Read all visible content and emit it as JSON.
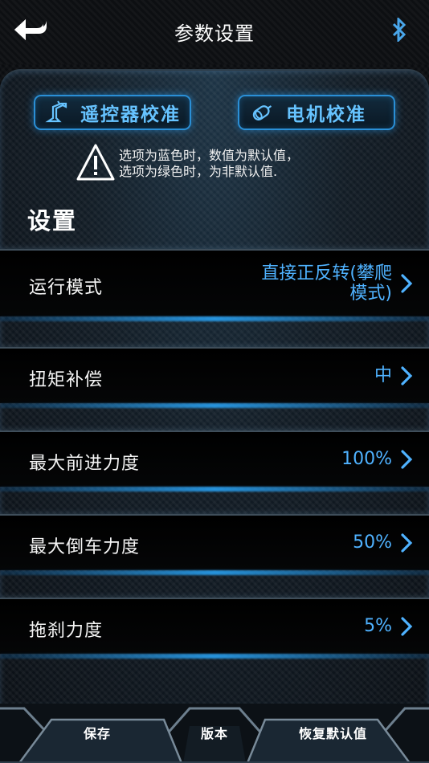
{
  "header": {
    "title": "参数设置",
    "back_icon": "back-arrow-icon",
    "bluetooth_icon": "bluetooth-icon"
  },
  "calibration": {
    "remote_label": "遥控器校准",
    "remote_icon": "remote-control-icon",
    "motor_label": "电机校准",
    "motor_icon": "motor-icon"
  },
  "warning": {
    "icon": "warning-triangle-icon",
    "line1": "选项为蓝色时，数值为默认值，",
    "line2": "选项为绿色时，为非默认值."
  },
  "settings": {
    "title": "设置",
    "rows": [
      {
        "label": "运行模式",
        "value_line1": "直接正反转(攀爬",
        "value_line2": "模式)"
      },
      {
        "label": "扭矩补偿",
        "value": "中"
      },
      {
        "label": "最大前进力度",
        "value": "100%"
      },
      {
        "label": "最大倒车力度",
        "value": "50%"
      },
      {
        "label": "拖刹力度",
        "value": "5%"
      }
    ]
  },
  "toolbar": {
    "save_label": "保存",
    "version_label": "版本",
    "restore_label": "恢复默认值"
  },
  "colors": {
    "accent_blue": "#4fb2ff",
    "glow_blue": "#2a8fd6",
    "text_white": "#ffffff"
  }
}
